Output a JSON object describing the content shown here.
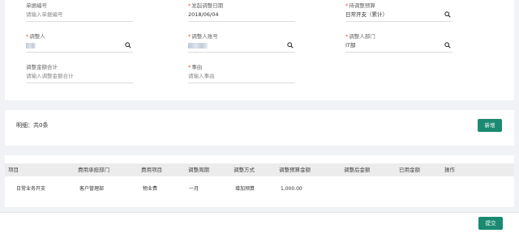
{
  "form": {
    "doc_no": {
      "label": "单据编号",
      "placeholder": "请输入单据编号"
    },
    "adjust_date": {
      "label": "发起调整日期",
      "value": "2018/06/04"
    },
    "budget": {
      "label": "待调整预算",
      "value": "日常开支（累计）"
    },
    "adjuster": {
      "label": "调整人"
    },
    "adjuster_acc": {
      "label": "调整人账号"
    },
    "adjuster_dept": {
      "label": "调整人部门",
      "value": "IT部"
    },
    "total": {
      "label": "调整金额合计",
      "placeholder": "请输入调整金额合计"
    },
    "reason": {
      "label": "事由",
      "placeholder": "请输入事由"
    }
  },
  "detail": {
    "title": "明细：共0条",
    "add_label": "新增"
  },
  "table": {
    "headers": [
      "项目",
      "费用承担部门",
      "费用项目",
      "调整周期",
      "调整方式",
      "调整预算金额",
      "调整后金额",
      "已用金额",
      "操作"
    ],
    "rows": [
      [
        "日常业务开支",
        "客户管理部",
        "物业费",
        "一月",
        "增加预算",
        "1,000.00",
        "",
        "",
        ""
      ]
    ]
  },
  "footer": {
    "submit_label": "提交"
  },
  "colors": {
    "accent": "#1a8a72",
    "required": "#e74c3c"
  }
}
